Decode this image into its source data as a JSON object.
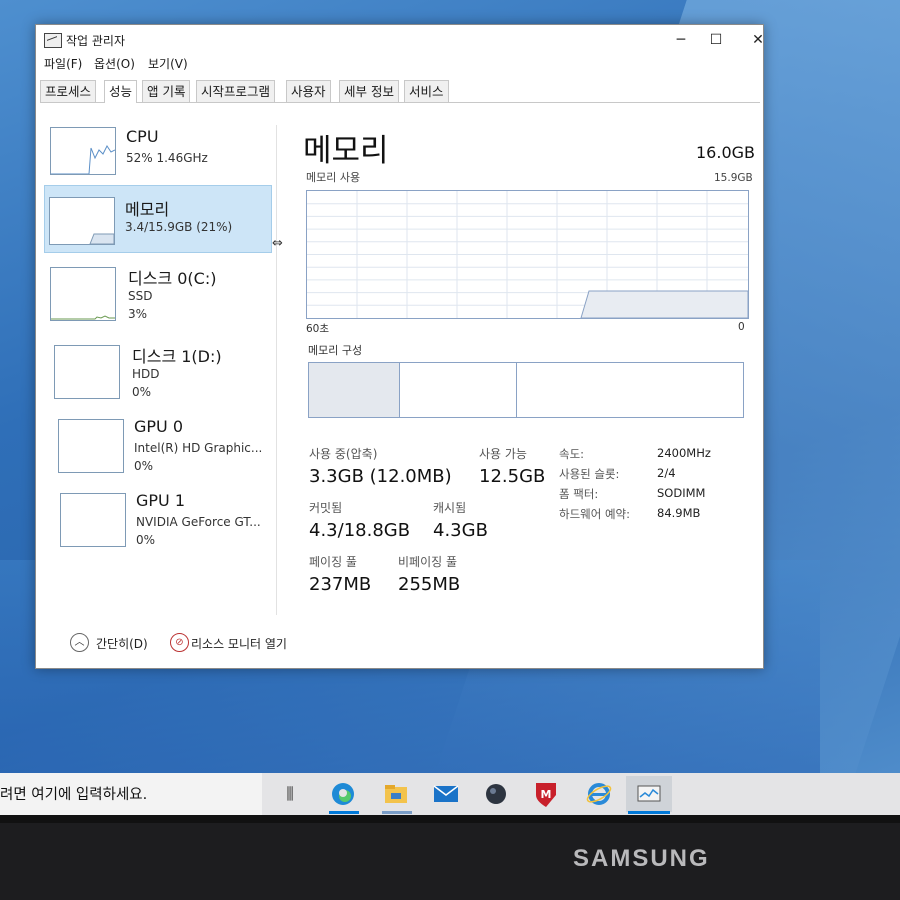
{
  "window": {
    "title": "작업 관리자",
    "menu": [
      "파일(F)",
      "옵션(O)",
      "보기(V)"
    ],
    "tabs": [
      "프로세스",
      "성능",
      "앱 기록",
      "시작프로그램",
      "사용자",
      "세부 정보",
      "서비스"
    ],
    "active_tab": "성능"
  },
  "sidebar": {
    "items": [
      {
        "name": "CPU",
        "line1": "52% 1.46GHz",
        "line2": "",
        "icon": "cpu-graph-icon"
      },
      {
        "name": "메모리",
        "line1": "3.4/15.9GB (21%)",
        "line2": "",
        "icon": "memory-graph-icon",
        "selected": true
      },
      {
        "name": "디스크 0(C:)",
        "line1": "SSD",
        "line2": "3%",
        "icon": "disk-graph-icon"
      },
      {
        "name": "디스크 1(D:)",
        "line1": "HDD",
        "line2": "0%",
        "icon": "disk-graph-icon"
      },
      {
        "name": "GPU 0",
        "line1": "Intel(R) HD Graphic...",
        "line2": "0%",
        "icon": "gpu-graph-icon"
      },
      {
        "name": "GPU 1",
        "line1": "NVIDIA GeForce GT...",
        "line2": "0%",
        "icon": "gpu-graph-icon"
      }
    ]
  },
  "memory": {
    "title": "메모리",
    "total": "16.0GB",
    "usage_label": "메모리 사용",
    "usage_max": "15.9GB",
    "axis_left": "60초",
    "axis_right": "0",
    "composition_label": "메모리 구성",
    "composition_fractions": [
      0.21,
      0.27,
      0.52
    ],
    "stats": {
      "in_use_label": "사용 중(압축)",
      "in_use_value": "3.3GB (12.0MB)",
      "available_label": "사용 가능",
      "available_value": "12.5GB",
      "committed_label": "커밋됨",
      "committed_value": "4.3/18.8GB",
      "cached_label": "캐시됨",
      "cached_value": "4.3GB",
      "paged_label": "페이징 풀",
      "paged_value": "237MB",
      "nonpaged_label": "비페이징 풀",
      "nonpaged_value": "255MB"
    },
    "specs": [
      {
        "key": "속도:",
        "value": "2400MHz"
      },
      {
        "key": "사용된 슬롯:",
        "value": "2/4"
      },
      {
        "key": "폼 팩터:",
        "value": "SODIMM"
      },
      {
        "key": "하드웨어 예약:",
        "value": "84.9MB"
      }
    ]
  },
  "footer": {
    "collapse_label": "간단히(D)",
    "resource_monitor_label": "리소스 모니터 열기"
  },
  "taskbar": {
    "search_text": "려면 여기에 입력하세요.",
    "icons": [
      "task-view-icon",
      "edge-icon",
      "file-explorer-icon",
      "mail-icon",
      "app-icon",
      "mcafee-icon",
      "internet-explorer-icon",
      "task-manager-icon"
    ]
  },
  "device": {
    "brand": "SAMSUNG"
  },
  "colors": {
    "accent": "#0078d7",
    "selected_bg": "#cde5f7",
    "memory_line": "#8aa2c5"
  }
}
